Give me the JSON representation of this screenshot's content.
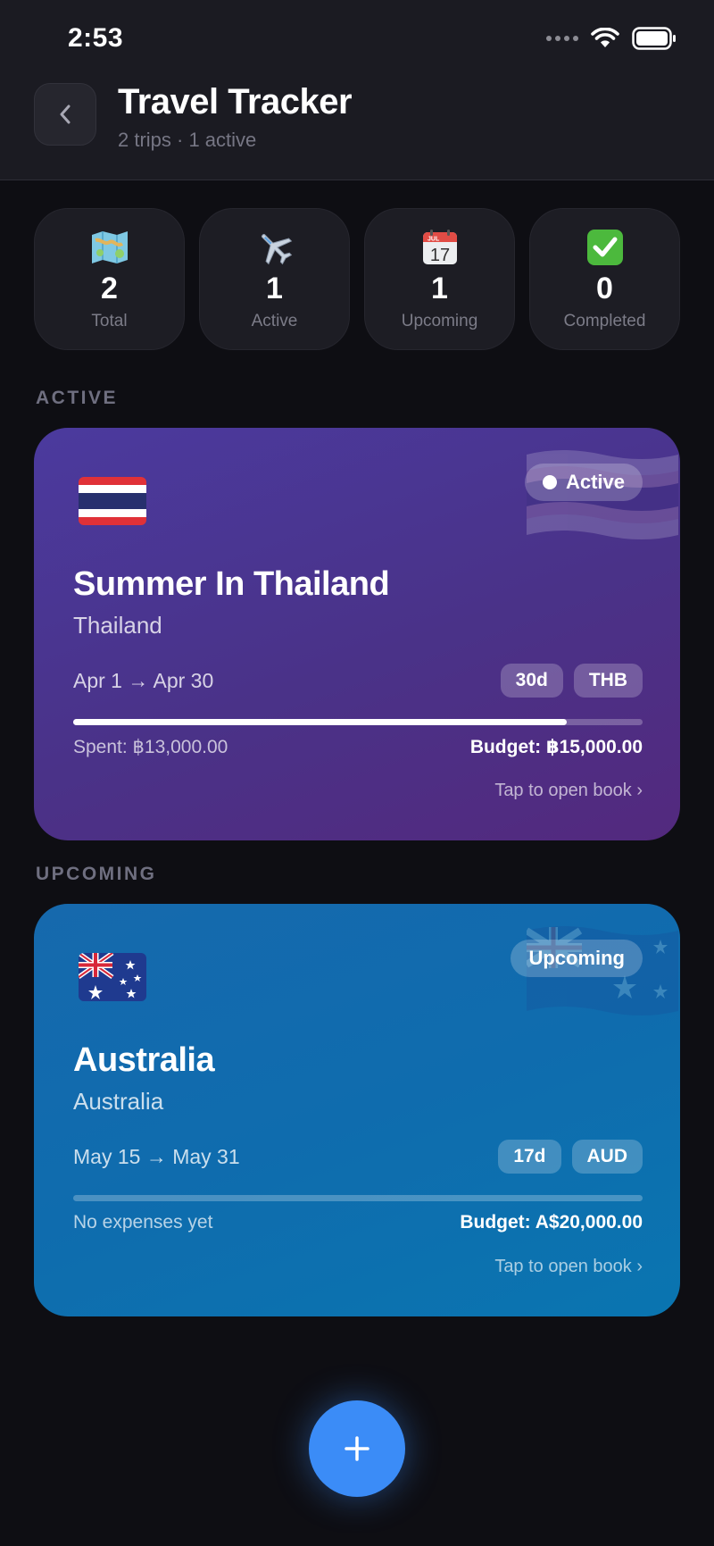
{
  "status_bar": {
    "time": "2:53"
  },
  "header": {
    "title": "Travel Tracker",
    "subtitle": "2 trips · 1 active"
  },
  "stats": [
    {
      "icon": "map-icon",
      "value": "2",
      "label": "Total"
    },
    {
      "icon": "airplane-icon",
      "value": "1",
      "label": "Active"
    },
    {
      "icon": "calendar-icon",
      "value": "1",
      "label": "Upcoming",
      "calendar_month": "JUL",
      "calendar_day": "17"
    },
    {
      "icon": "checkmark-icon",
      "value": "0",
      "label": "Completed"
    }
  ],
  "sections": {
    "active": "ACTIVE",
    "upcoming": "UPCOMING"
  },
  "trips": [
    {
      "name": "Summer In Thailand",
      "country": "Thailand",
      "flag": "thailand-flag-icon",
      "status": "Active",
      "dates": "Apr 1 → Apr 30",
      "duration": "30d",
      "currency": "THB",
      "spent": "Spent: ฿13,000.00",
      "budget": "Budget: ฿15,000.00",
      "progress": 0.867,
      "link": "Tap to open book ›",
      "colors": {
        "start": "#4b3a9e",
        "end": "#53297e"
      }
    },
    {
      "name": "Australia",
      "country": "Australia",
      "flag": "australia-flag-icon",
      "status": "Upcoming",
      "dates": "May 15 → May 31",
      "duration": "17d",
      "currency": "AUD",
      "spent": "No expenses yet",
      "budget": "Budget: A$20,000.00",
      "progress": 0,
      "link": "Tap to open book ›",
      "colors": {
        "start": "#1669ad",
        "end": "#0a75b0"
      }
    }
  ],
  "fab": {
    "icon": "plus-icon",
    "color": "#3b8cf7"
  }
}
